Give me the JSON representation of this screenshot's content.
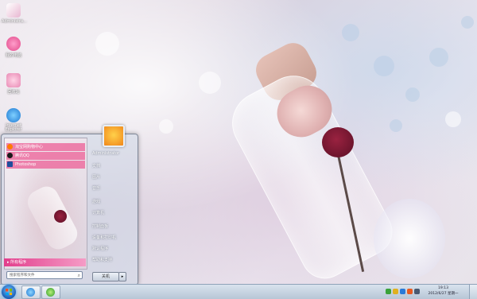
{
  "desktop": {
    "icons": [
      {
        "label": "Administra..."
      },
      {
        "label": "我的电脑"
      },
      {
        "label": "回收站"
      },
      {
        "label": "Internet Explorer"
      }
    ]
  },
  "start_menu": {
    "pinned_items": [
      {
        "label": "淘宝网购物中心"
      },
      {
        "label": "腾讯QQ"
      },
      {
        "label": "Photoshop"
      }
    ],
    "all_programs_label": "所有程序",
    "search_placeholder": "搜索程序和文件",
    "right_items": [
      {
        "label": "Administrator"
      },
      {
        "label": "文档"
      },
      {
        "label": "图片"
      },
      {
        "label": "音乐"
      },
      {
        "label": "游戏"
      },
      {
        "label": "计算机"
      },
      {
        "label": "控制面板"
      },
      {
        "label": "设备和打印机"
      },
      {
        "label": "默认程序"
      },
      {
        "label": "帮助和支持"
      }
    ],
    "shutdown_label": "关机"
  },
  "taskbar": {
    "clock_time": "19:13",
    "clock_date": "2012/6/27 星期一"
  },
  "colors": {
    "all_programs_highlight": "#e23e8c",
    "taskbar": "#c6d3e1"
  }
}
